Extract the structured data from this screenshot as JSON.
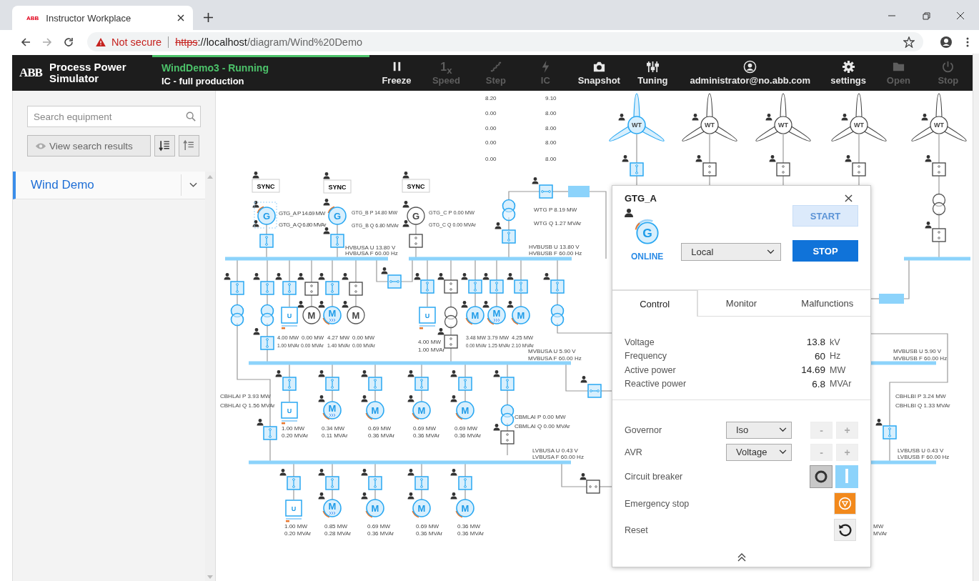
{
  "browser": {
    "tab_title": "Instructor Workplace",
    "favicon_text": "ABB",
    "security": "Not secure",
    "url_scheme": "https",
    "url_host": "://localhost",
    "url_path": "/diagram/Wind%20Demo"
  },
  "header": {
    "logo": "ABB",
    "product": "Process Power Simulator",
    "status": "WindDemo3 - Running",
    "scenario": "IC - full production",
    "tools": [
      {
        "kind": "freeze",
        "label": "Freeze",
        "disabled": false
      },
      {
        "kind": "speed",
        "label": "Speed",
        "icon_text": "1$_{x}$",
        "disabled": true
      },
      {
        "kind": "step",
        "label": "Step",
        "disabled": true
      },
      {
        "kind": "ic",
        "label": "IC",
        "disabled": true
      },
      {
        "kind": "snapshot",
        "label": "Snapshot",
        "disabled": false
      },
      {
        "kind": "tuning",
        "label": "Tuning",
        "disabled": false
      },
      {
        "kind": "user",
        "label": "administrator@no.abb.com",
        "disabled": false
      },
      {
        "kind": "settings",
        "label": "settings",
        "disabled": false
      },
      {
        "kind": "open",
        "label": "Open",
        "disabled": true
      },
      {
        "kind": "stop",
        "label": "Stop",
        "disabled": true
      }
    ]
  },
  "sidebar": {
    "search": {
      "placeholder": "Search equipment"
    },
    "view_button": "View search results",
    "items": [
      {
        "label": "Wind Demo",
        "selected": true
      }
    ]
  },
  "diagram": {
    "labels": [
      "8.20",
      "9.10",
      "0.00",
      "8.00",
      "0.00",
      "8.00",
      "0.00",
      "8.00",
      "0.00",
      "8.00",
      "GTG_A P 14.69 MW",
      "GTG_A Q 6.80 MVAr",
      "GTG_B P 14.80 MW",
      "GTG_B Q 6.80 MVAr",
      "GTG_C P 0.00 MW",
      "GTG_C Q 0.00 MVAr",
      "HVBUSA U 13.80 V",
      "HVBUSA F 60.00 Hz",
      "WTG P 8.19 MW",
      "WTG Q 1.27 MVAr",
      "HVBUSB U 13.80 V",
      "HVBUSB F 60.00 Hz",
      "4.00 MW",
      "0.00 MW",
      "4.27 MW",
      "0.00 MW",
      "1.00 MVAr",
      "0.00 MVAr",
      "1.40 MVAr",
      "0.00 MVAr",
      "4.00 MW",
      "1.00 MVAr",
      "3.48 MW",
      "3.79 MW",
      "4.25 MW",
      "0.00 MVAr",
      "1.25 MVAr",
      "2.10 MVAr",
      "MVBUSA U 5.90 V",
      "MVBUSA F 60.00 Hz",
      "CBHLAI P 3.93 MW",
      "CBHLAI Q 1.56 MVAr",
      "1.00 MW",
      "0.20 MVAr",
      "0.34 MW",
      "0.11 MVAr",
      "0.69 MW",
      "0.36 MVAr",
      "0.69 MW",
      "0.36 MVAr",
      "0.69 MW",
      "0.36 MVAr",
      "CBMLAI P 0.00 MW",
      "CBMLAI Q 0.00 MVAr",
      "LVBUSA U 0.43 V",
      "LVBUSA F 60.00 Hz",
      "1.00 MW",
      "0.20 MVAr",
      "0.85 MW",
      "0.28 MVAr",
      "0.69 MW",
      "0.36 MVAr",
      "0.69 MW",
      "0.36 MVAr",
      "0.36 MW",
      "0.36 MVAr",
      "MVBUSB U 5.90 V",
      "MVBUSB F 60.00 Hz",
      "CBHLBI P 3.24 MW",
      "CBHLBI Q 1.33 MVAr",
      "LVBUSB U 0.43 V",
      "LVBUSB F 60.00 Hz",
      "MW",
      "MVAr"
    ],
    "nodes": [
      {
        "kind": "sync",
        "label": "SYNC"
      },
      {
        "kind": "sync",
        "label": "SYNC"
      },
      {
        "kind": "sync",
        "label": "SYNC"
      },
      {
        "kind": "gen",
        "label": "G",
        "energized": true,
        "selected": true
      },
      {
        "kind": "gen",
        "label": "G",
        "energized": true,
        "selected": false
      },
      {
        "kind": "gen",
        "label": "G",
        "energized": false,
        "selected": false
      },
      {
        "kind": "breaker",
        "closed": true
      },
      {
        "kind": "breaker",
        "closed": true
      },
      {
        "kind": "breaker",
        "closed": false
      },
      {
        "kind": "xfmr",
        "energized": true
      },
      {
        "kind": "breaker",
        "closed": true
      },
      {
        "kind": "breaker",
        "closed": true
      },
      {
        "kind": "breaker",
        "closed": true
      },
      {
        "kind": "breaker",
        "closed": true
      },
      {
        "kind": "xfmr",
        "energized": true
      },
      {
        "kind": "breaker",
        "closed": true
      },
      {
        "kind": "xfmr",
        "energized": true
      },
      {
        "kind": "breaker",
        "closed": true
      },
      {
        "kind": "breaker",
        "closed": true
      },
      {
        "kind": "ups",
        "label": "U",
        "energized": true
      },
      {
        "kind": "breaker",
        "closed": false
      },
      {
        "kind": "motor",
        "label": "M",
        "energized": false
      },
      {
        "kind": "breaker",
        "closed": true
      },
      {
        "kind": "drive",
        "label": "M",
        "energized": true
      },
      {
        "kind": "breaker",
        "closed": false
      },
      {
        "kind": "motor",
        "label": "M",
        "energized": false
      },
      {
        "kind": "breaker",
        "closed": true
      },
      {
        "kind": "ups",
        "label": "U",
        "energized": true
      },
      {
        "kind": "breaker",
        "closed": false
      },
      {
        "kind": "xfmr",
        "energized": false
      },
      {
        "kind": "breaker",
        "closed": false
      },
      {
        "kind": "breaker",
        "closed": true
      },
      {
        "kind": "motor",
        "label": "M",
        "energized": true
      },
      {
        "kind": "breaker",
        "closed": true
      },
      {
        "kind": "drive",
        "label": "M",
        "energized": true
      },
      {
        "kind": "breaker",
        "closed": true
      },
      {
        "kind": "motor",
        "label": "M",
        "energized": true
      },
      {
        "kind": "breaker",
        "closed": true
      },
      {
        "kind": "xfmr",
        "energized": true
      },
      {
        "kind": "breaker",
        "closed": true
      },
      {
        "kind": "ups",
        "label": "U",
        "energized": true
      },
      {
        "kind": "breaker",
        "closed": true
      },
      {
        "kind": "drive",
        "label": "M",
        "energized": true
      },
      {
        "kind": "breaker",
        "closed": true
      },
      {
        "kind": "motor",
        "label": "M",
        "energized": true
      },
      {
        "kind": "breaker",
        "closed": true
      },
      {
        "kind": "motor",
        "label": "M",
        "energized": true
      },
      {
        "kind": "breaker",
        "closed": true
      },
      {
        "kind": "motor",
        "label": "M",
        "energized": true
      },
      {
        "kind": "breaker",
        "closed": true
      },
      {
        "kind": "xfmr",
        "energized": true
      },
      {
        "kind": "breaker",
        "closed": false
      },
      {
        "kind": "breaker",
        "closed": true
      },
      {
        "kind": "breaker",
        "closed": true
      },
      {
        "kind": "breaker",
        "closed": true
      },
      {
        "kind": "ups",
        "label": "U",
        "energized": true
      },
      {
        "kind": "breaker",
        "closed": true
      },
      {
        "kind": "drive",
        "label": "M",
        "energized": true
      },
      {
        "kind": "breaker",
        "closed": true
      },
      {
        "kind": "motor",
        "label": "M",
        "energized": true
      },
      {
        "kind": "breaker",
        "closed": true
      },
      {
        "kind": "motor",
        "label": "M",
        "energized": true
      },
      {
        "kind": "breaker",
        "closed": true
      },
      {
        "kind": "motor",
        "label": "M",
        "energized": true
      },
      {
        "kind": "breaker",
        "closed": false
      },
      {
        "kind": "turbine",
        "label": "WT",
        "energized": true
      },
      {
        "kind": "turbine",
        "label": "WT",
        "energized": false
      },
      {
        "kind": "turbine",
        "label": "WT",
        "energized": false
      },
      {
        "kind": "turbine",
        "label": "WT",
        "energized": false
      },
      {
        "kind": "turbine",
        "label": "WT",
        "energized": false
      },
      {
        "kind": "breaker",
        "closed": true
      },
      {
        "kind": "breaker",
        "closed": false
      },
      {
        "kind": "breaker",
        "closed": false
      },
      {
        "kind": "breaker",
        "closed": false
      },
      {
        "kind": "breaker",
        "closed": false
      },
      {
        "kind": "xfmr",
        "energized": false
      },
      {
        "kind": "breaker",
        "closed": false
      },
      {
        "kind": "breaker",
        "closed": true
      }
    ]
  },
  "panel": {
    "title": "GTG_A",
    "symbol": "G",
    "state": "ONLINE",
    "mode": "Local",
    "buttons": [
      {
        "label": "START",
        "disabled": true
      },
      {
        "label": "STOP",
        "disabled": false
      }
    ],
    "tabs": [
      {
        "label": "Control",
        "selected": true
      },
      {
        "label": "Monitor",
        "selected": false
      },
      {
        "label": "Malfunctions",
        "selected": false
      }
    ],
    "readings": [
      {
        "name": "Voltage",
        "value": "13.8",
        "unit": "kV"
      },
      {
        "name": "Frequency",
        "value": "60",
        "unit": "Hz"
      },
      {
        "name": "Active power",
        "value": "14.69",
        "unit": "MW"
      },
      {
        "name": "Reactive power",
        "value": "6.8",
        "unit": "MVAr"
      }
    ],
    "controls": [
      {
        "kind": "select",
        "label": "Governor",
        "value": "Iso",
        "minus": "-",
        "plus": "+",
        "disabled": true
      },
      {
        "kind": "select",
        "label": "AVR",
        "value": "Voltage",
        "minus": "-",
        "plus": "+",
        "disabled": true
      },
      {
        "kind": "breaker",
        "label": "Circuit breaker",
        "closed": true
      },
      {
        "kind": "estop",
        "label": "Emergency stop"
      },
      {
        "kind": "reset",
        "label": "Reset"
      }
    ]
  }
}
